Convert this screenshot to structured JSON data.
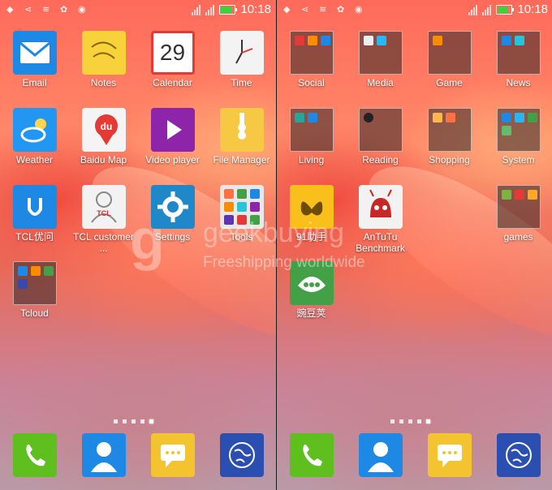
{
  "status": {
    "time": "10:18"
  },
  "left": {
    "apps": [
      {
        "label": "Email"
      },
      {
        "label": "Notes"
      },
      {
        "label": "Calendar",
        "day": "29"
      },
      {
        "label": "Time"
      },
      {
        "label": "Weather"
      },
      {
        "label": "Baidu Map",
        "badge": "du"
      },
      {
        "label": "Video player"
      },
      {
        "label": "File Manager"
      },
      {
        "label": "TCL优问"
      },
      {
        "label": "TCL customer ...",
        "brand": "TCL"
      },
      {
        "label": "Settings"
      },
      {
        "label": "Tools"
      },
      {
        "label": "Tcloud"
      }
    ]
  },
  "right": {
    "folders": [
      {
        "label": "Social"
      },
      {
        "label": "Media"
      },
      {
        "label": "Game"
      },
      {
        "label": "News"
      },
      {
        "label": "Living"
      },
      {
        "label": "Reading"
      },
      {
        "label": "Shopping"
      },
      {
        "label": "System"
      }
    ],
    "apps": [
      {
        "label": "91助手"
      },
      {
        "label": "AnTuTu Benchmark"
      },
      {
        "label": "games"
      },
      {
        "label": "豌豆荚"
      }
    ]
  },
  "watermark": {
    "brand": "geekbuying",
    "tagline": "Freeshipping worldwide"
  },
  "page_indicator": {
    "count": 5
  },
  "colors": {
    "phone": "#5fbf1f",
    "contacts": "#1e88e5",
    "messaging": "#f4c430",
    "browser": "#2a4fb0"
  }
}
